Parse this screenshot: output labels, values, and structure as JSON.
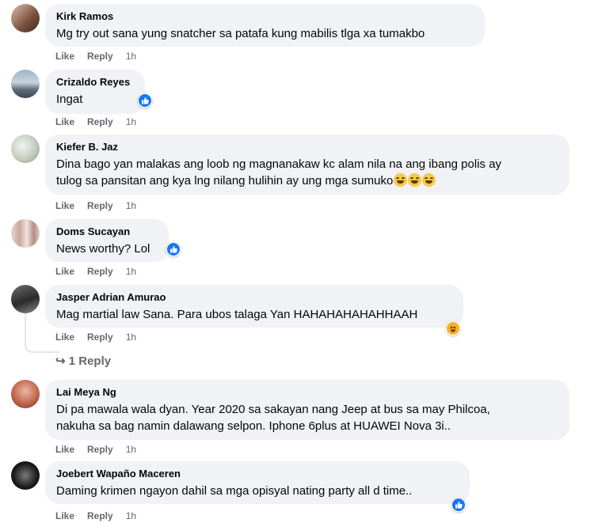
{
  "actions": {
    "like": "Like",
    "reply": "Reply"
  },
  "comments": [
    {
      "name": "Kirk Ramos",
      "lines": [
        "Mg try out sana yung snatcher sa patafa kung mabilis tlga xa tumakbo"
      ],
      "time": "1h",
      "reaction": null
    },
    {
      "name": "Crizaldo Reyes",
      "lines": [
        "Ingat"
      ],
      "time": "1h",
      "reaction": "like"
    },
    {
      "name": "Kiefer B. Jaz",
      "lines": [
        "Dina bago yan malakas ang loob ng magnanakaw kc alam nila na ang ibang polis ay",
        "tulog sa pansitan ang kya lng nilang hulihin ay ung mga sumuko"
      ],
      "time": "1h",
      "reaction": null,
      "trailing_emoji": "laughing-emoji"
    },
    {
      "name": "Doms Sucayan",
      "lines": [
        "News worthy? Lol"
      ],
      "time": "1h",
      "reaction": "like"
    },
    {
      "name": "Jasper Adrian Amurao",
      "lines": [
        "Mag martial law Sana. Para ubos talaga Yan HAHAHAHAHAHHAAH"
      ],
      "time": "1h",
      "reaction": "haha"
    },
    {
      "name": "Lai Meya Ng",
      "lines": [
        "Di pa mawala wala dyan. Year 2020 sa sakayan nang Jeep at bus sa may Philcoa,",
        "nakuha sa bag namin dalawang selpon. Iphone 6plus at HUAWEI Nova 3i.."
      ],
      "time": "1h",
      "reaction": null
    },
    {
      "name": "Joebert Wapaño Maceren",
      "lines": [
        "Daming krimen ngayon dahil sa mga opisyal nating party all d time.."
      ],
      "time": "1h",
      "reaction": "like"
    }
  ],
  "reply_thread": {
    "arrow": "↪",
    "label": "1 Reply"
  },
  "colors": {
    "bubble": "#f0f2f5",
    "muted": "#65676b",
    "like_blue": "#1877f2",
    "haha_yellow": "#f7b125"
  }
}
